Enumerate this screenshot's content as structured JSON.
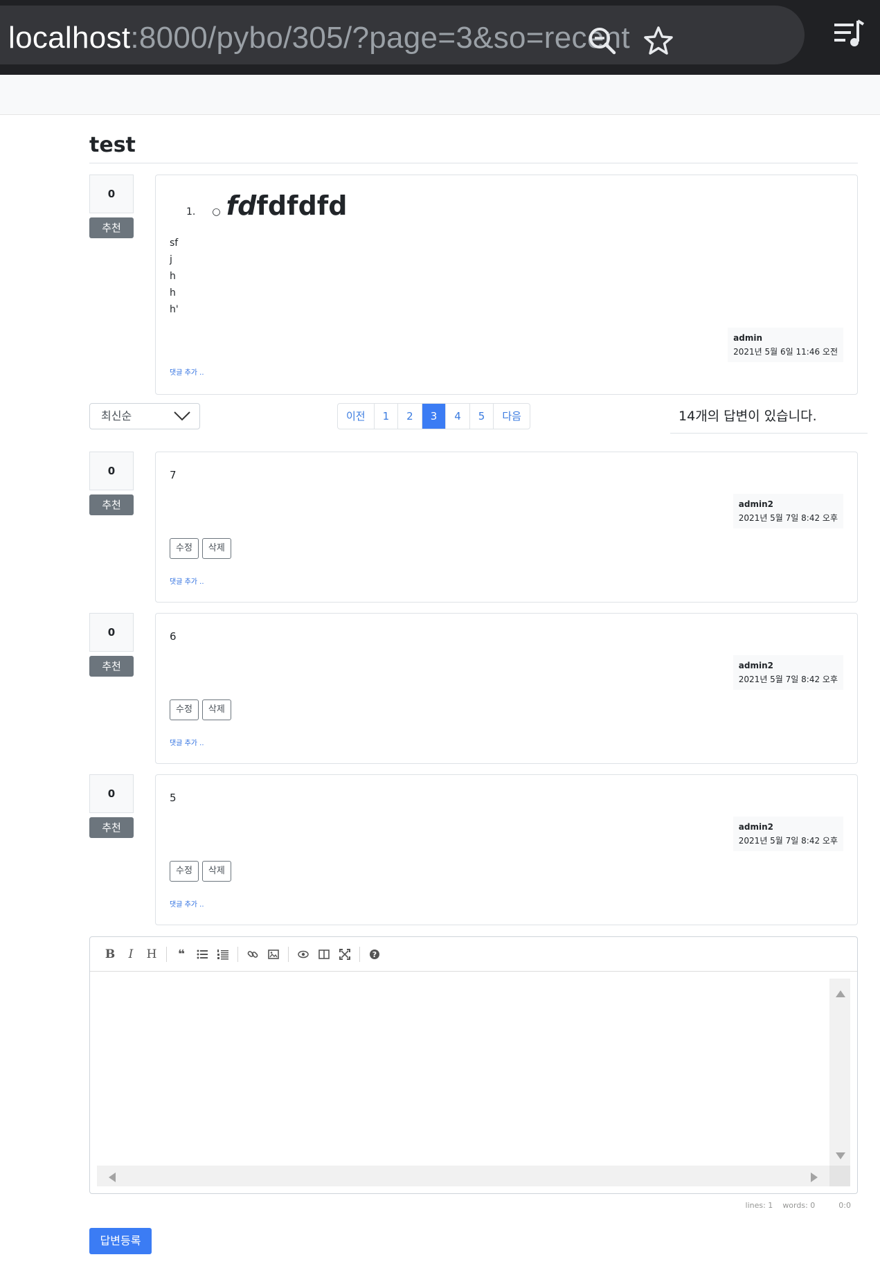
{
  "browser": {
    "url_host": "localhost",
    "url_rest": ":8000/pybo/305/?page=3&so=recent",
    "icons": [
      "zoom-out-icon",
      "star-icon",
      "playlist-icon"
    ]
  },
  "question": {
    "title": "test",
    "votes": "0",
    "vote_label": "추천",
    "list_number": "1.",
    "heading_italic": "fd",
    "heading_rest": "fdfdfd",
    "lines": [
      "sf",
      "j",
      "h",
      "h",
      "h'"
    ],
    "author": "admin",
    "date": "2021년 5월 6일 11:46 오전",
    "comment_link": "댓글 추가 .."
  },
  "sort": {
    "selected": "최신순"
  },
  "pagination": {
    "prev": "이전",
    "pages": [
      "1",
      "2",
      "3",
      "4",
      "5"
    ],
    "active_page": "3",
    "next": "다음"
  },
  "answer_count": {
    "number": "14",
    "text": "개의 답변이 있습니다."
  },
  "answers": [
    {
      "votes": "0",
      "vote_label": "추천",
      "content": "7",
      "author": "admin2",
      "date": "2021년 5월 7일 8:42 오후",
      "edit": "수정",
      "delete": "삭제",
      "comment_link": "댓글 추가 .."
    },
    {
      "votes": "0",
      "vote_label": "추천",
      "content": "6",
      "author": "admin2",
      "date": "2021년 5월 7일 8:42 오후",
      "edit": "수정",
      "delete": "삭제",
      "comment_link": "댓글 추가 .."
    },
    {
      "votes": "0",
      "vote_label": "추천",
      "content": "5",
      "author": "admin2",
      "date": "2021년 5월 7일 8:42 오후",
      "edit": "수정",
      "delete": "삭제",
      "comment_link": "댓글 추가 .."
    }
  ],
  "editor": {
    "toolbar": [
      "bold-icon",
      "italic-icon",
      "heading-icon",
      "quote-icon",
      "unordered-list-icon",
      "ordered-list-icon",
      "link-icon",
      "image-icon",
      "preview-icon",
      "side-by-side-icon",
      "fullscreen-icon",
      "help-icon"
    ],
    "status_lines": "lines: 1",
    "status_words": "words: 0",
    "status_cursor": "0:0",
    "submit_label": "답변등록"
  },
  "colors": {
    "primary": "#3b7cf4",
    "secondary": "#6c757d",
    "chrome_bg": "#202124"
  }
}
